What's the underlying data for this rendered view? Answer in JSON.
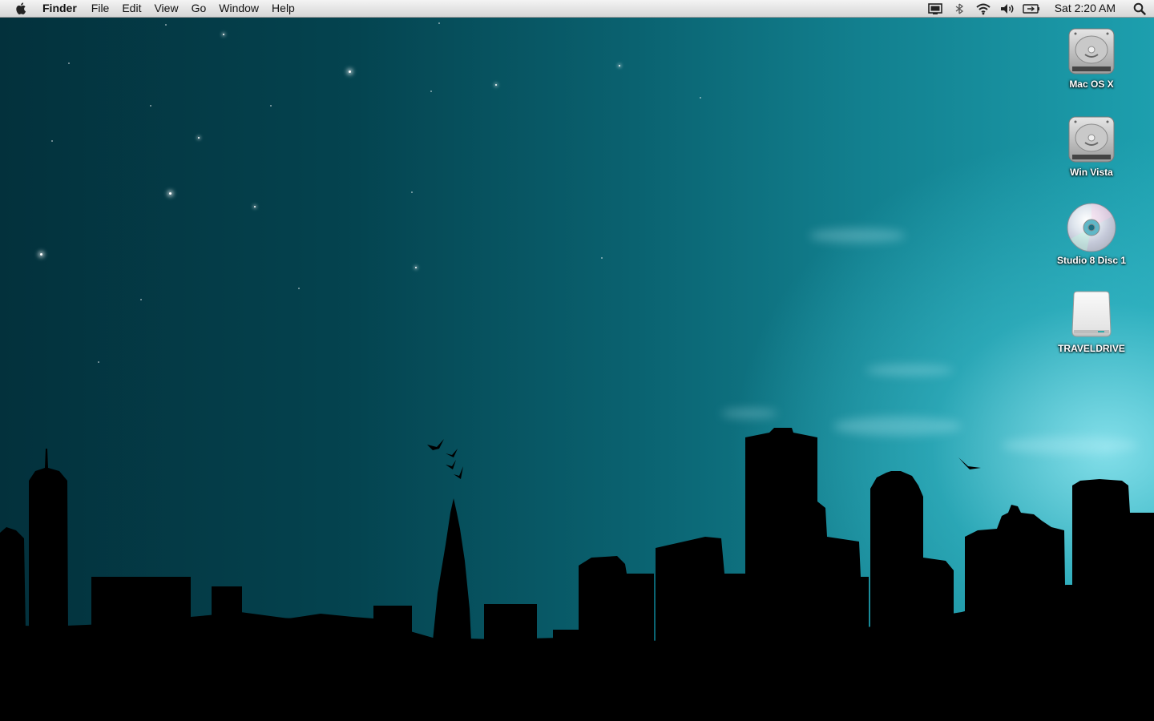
{
  "menubar": {
    "apple_menu_icon": "apple-icon",
    "app_name": "Finder",
    "menus": [
      "File",
      "Edit",
      "View",
      "Go",
      "Window",
      "Help"
    ],
    "status_icons": [
      "display-mirroring-icon",
      "bluetooth-icon",
      "wifi-icon",
      "volume-icon",
      "battery-icon"
    ],
    "clock": "Sat 2:20 AM",
    "spotlight_icon": "spotlight-search-icon"
  },
  "desktop": {
    "wallpaper": "night city skyline",
    "colors": {
      "sky_dark": "#03313c",
      "sky_light": "#1d9fae",
      "skyline": "#000000"
    },
    "icons": [
      {
        "label": "Mac OS X",
        "icon": "hard-drive-icon"
      },
      {
        "label": "Win Vista",
        "icon": "hard-drive-icon"
      },
      {
        "label": "Studio 8 Disc 1",
        "icon": "cd-disc-icon"
      },
      {
        "label": "TRAVELDRIVE",
        "icon": "external-drive-icon"
      }
    ]
  }
}
